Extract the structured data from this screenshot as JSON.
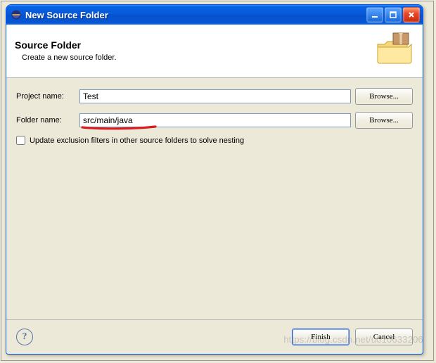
{
  "window": {
    "title": "New Source Folder"
  },
  "header": {
    "title": "Source Folder",
    "subtitle": "Create a new source folder."
  },
  "form": {
    "project_label": "Project name:",
    "project_value": "Test",
    "project_browse": "Browse...",
    "folder_label": "Folder name:",
    "folder_value": "src/main/java",
    "folder_browse": "Browse...",
    "checkbox_label": "Update exclusion filters in other source folders to solve nesting"
  },
  "footer": {
    "finish": "Finish",
    "cancel": "Cancel"
  },
  "icons": {
    "eclipse": "eclipse-icon",
    "minimize": "minimize-icon",
    "maximize": "maximize-icon",
    "close": "close-icon",
    "folder_art": "package-folder-icon",
    "help": "help-icon"
  },
  "colors": {
    "titlebar": "#0859d8",
    "close": "#e1492e",
    "panel": "#ece9d8",
    "input_border": "#7f9db9",
    "underline": "#d81e1e"
  },
  "watermark": "https://blog.csdn.net/u010633206"
}
